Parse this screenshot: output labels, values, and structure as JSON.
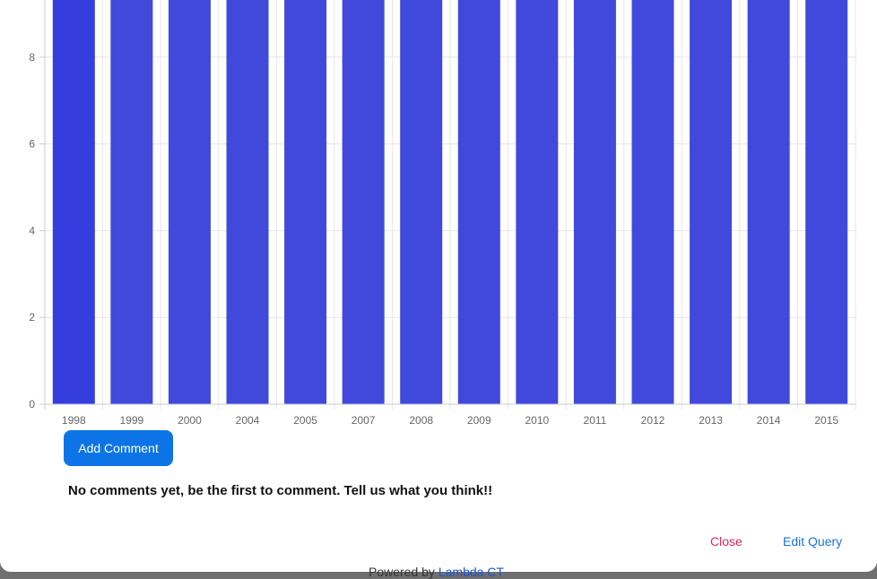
{
  "chart_data": {
    "type": "bar",
    "categories": [
      "1998",
      "1999",
      "2000",
      "2004",
      "2005",
      "2007",
      "2008",
      "2009",
      "2010",
      "2011",
      "2012",
      "2013",
      "2014",
      "2015"
    ],
    "values": [
      10,
      10,
      10,
      10,
      10,
      10,
      10,
      10,
      10,
      10,
      10,
      10,
      10,
      10
    ],
    "y_ticks": [
      "0",
      "2",
      "4",
      "6",
      "8"
    ],
    "ylim": [
      0,
      9.3
    ],
    "grid": true,
    "colors": {
      "bar": "#4049dc",
      "bar_first": "#363ddf",
      "grid": "#e6e6e6",
      "axis": "#cccccc",
      "tick_text": "#666666"
    }
  },
  "comments": {
    "add_button": "Add Comment",
    "empty_message": "No comments yet, be the first to comment. Tell us what you think!!"
  },
  "footer": {
    "close": "Close",
    "edit_query": "Edit Query"
  },
  "background": {
    "powered_prefix": "Powered by",
    "powered_link": "Lambda CT"
  }
}
